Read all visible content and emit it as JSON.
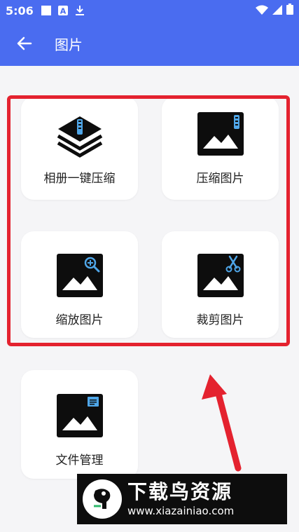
{
  "status_bar": {
    "time": "5:06"
  },
  "app_bar": {
    "title": "图片"
  },
  "cards": [
    {
      "label": "相册一键压缩",
      "icon": "stack-zip-icon"
    },
    {
      "label": "压缩图片",
      "icon": "image-zip-icon"
    },
    {
      "label": "缩放图片",
      "icon": "image-zoom-icon"
    },
    {
      "label": "裁剪图片",
      "icon": "image-crop-icon"
    },
    {
      "label": "文件管理",
      "icon": "image-file-icon"
    }
  ],
  "watermark": {
    "title": "下载鸟资源",
    "url": "www.xiazainiao.com"
  },
  "colors": {
    "primary": "#4a6cf0",
    "highlight": "#e4222f",
    "arrow": "#e4222f",
    "icon_dark": "#0d0d0d",
    "icon_accent": "#4fa6e8"
  }
}
